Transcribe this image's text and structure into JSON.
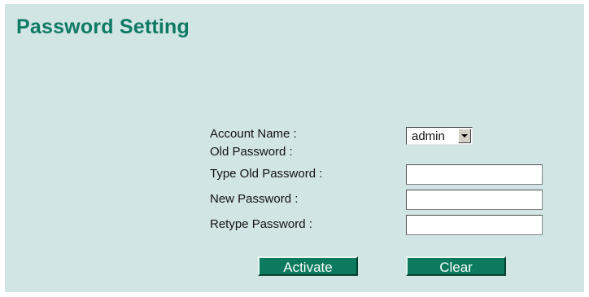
{
  "title": "Password Setting",
  "form": {
    "account_name_label": "Account Name :",
    "account_name_value": "admin",
    "old_password_label": "Old Password :",
    "type_old_password_label": "Type Old Password :",
    "new_password_label": "New Password :",
    "retype_password_label": "Retype Password :",
    "type_old_password_value": "",
    "new_password_value": "",
    "retype_password_value": ""
  },
  "buttons": {
    "activate": "Activate",
    "clear": "Clear"
  },
  "colors": {
    "background": "#d2e5e5",
    "title": "#0d7a63",
    "button": "#0b7a5e"
  }
}
